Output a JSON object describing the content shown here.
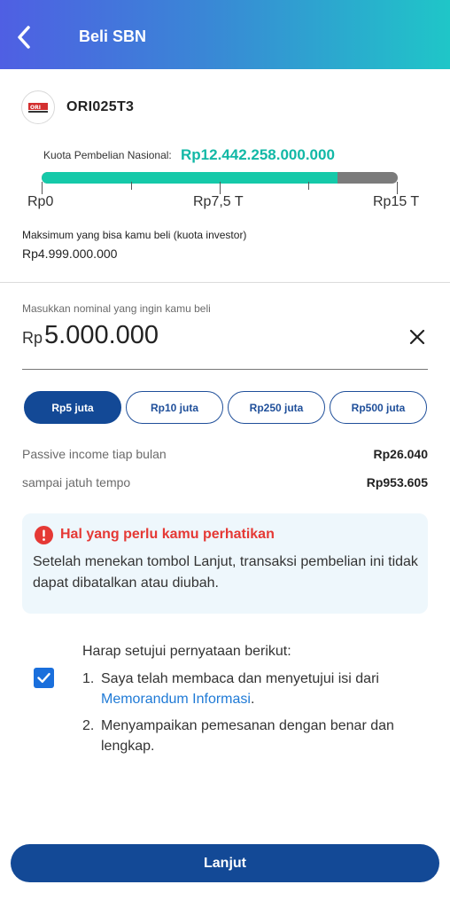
{
  "header": {
    "title": "Beli SBN"
  },
  "product": {
    "name": "ORI025T3",
    "logo_text": "ORI"
  },
  "quota": {
    "label": "Kuota Pembelian Nasional:",
    "value": "Rp12.442.258.000.000",
    "fill_fraction": 0.83,
    "ticks": [
      "Rp0",
      "Rp7,5 T",
      "Rp15 T"
    ],
    "colors": {
      "fill": "#15c9a9",
      "track": "#7b7b7b"
    }
  },
  "investor_quota": {
    "label": "Maksimum yang bisa kamu beli (kuota investor)",
    "value": "Rp4.999.000.000"
  },
  "amount_input": {
    "label": "Masukkan nominal yang ingin kamu beli",
    "currency": "Rp",
    "value": "5.000.000"
  },
  "chips": [
    {
      "label": "Rp5 juta",
      "selected": true
    },
    {
      "label": "Rp10 juta",
      "selected": false
    },
    {
      "label": "Rp250 juta",
      "selected": false
    },
    {
      "label": "Rp500 juta",
      "selected": false
    }
  ],
  "income": {
    "monthly_label": "Passive income tiap bulan",
    "monthly_value": "Rp26.040",
    "maturity_label": "sampai jatuh tempo",
    "maturity_value": "Rp953.605"
  },
  "notice": {
    "title": "Hal yang perlu kamu perhatikan",
    "body": "Setelah menekan tombol Lanjut, transaksi pembelian ini tidak dapat dibatalkan atau diubah."
  },
  "agreement": {
    "checked": true,
    "title": "Harap setujui pernyataan berikut:",
    "item1_num": "1.",
    "item1_text": "Saya telah membaca dan menyetujui isi dari",
    "item1_link": "Memorandum Informasi",
    "item1_suffix": ".",
    "item2_num": "2.",
    "item2_text": "Menyampaikan pemesanan dengan benar dan lengkap."
  },
  "cta": {
    "label": "Lanjut"
  },
  "colors": {
    "primary": "#134996",
    "accent": "#12b8a6",
    "warning": "#e53935",
    "link": "#1f7ad6"
  }
}
